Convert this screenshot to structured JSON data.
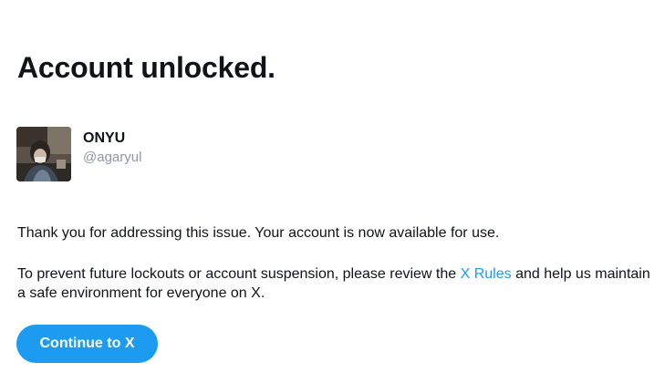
{
  "page": {
    "title": "Account unlocked."
  },
  "profile": {
    "display_name": "ONYU",
    "handle": "@agaryul",
    "avatar_icon": "profile-photo"
  },
  "message": {
    "line1": "Thank you for addressing this issue. Your account is now available for use.",
    "line2_before": "To prevent future lockouts or account suspension, please review the ",
    "line2_link": "X Rules",
    "line2_after": " and help us maintain a safe environment for everyone on X."
  },
  "actions": {
    "continue_label": "Continue to X"
  },
  "colors": {
    "accent": "#1d9bf0",
    "text": "#0f1419",
    "muted": "#8b98a5"
  }
}
